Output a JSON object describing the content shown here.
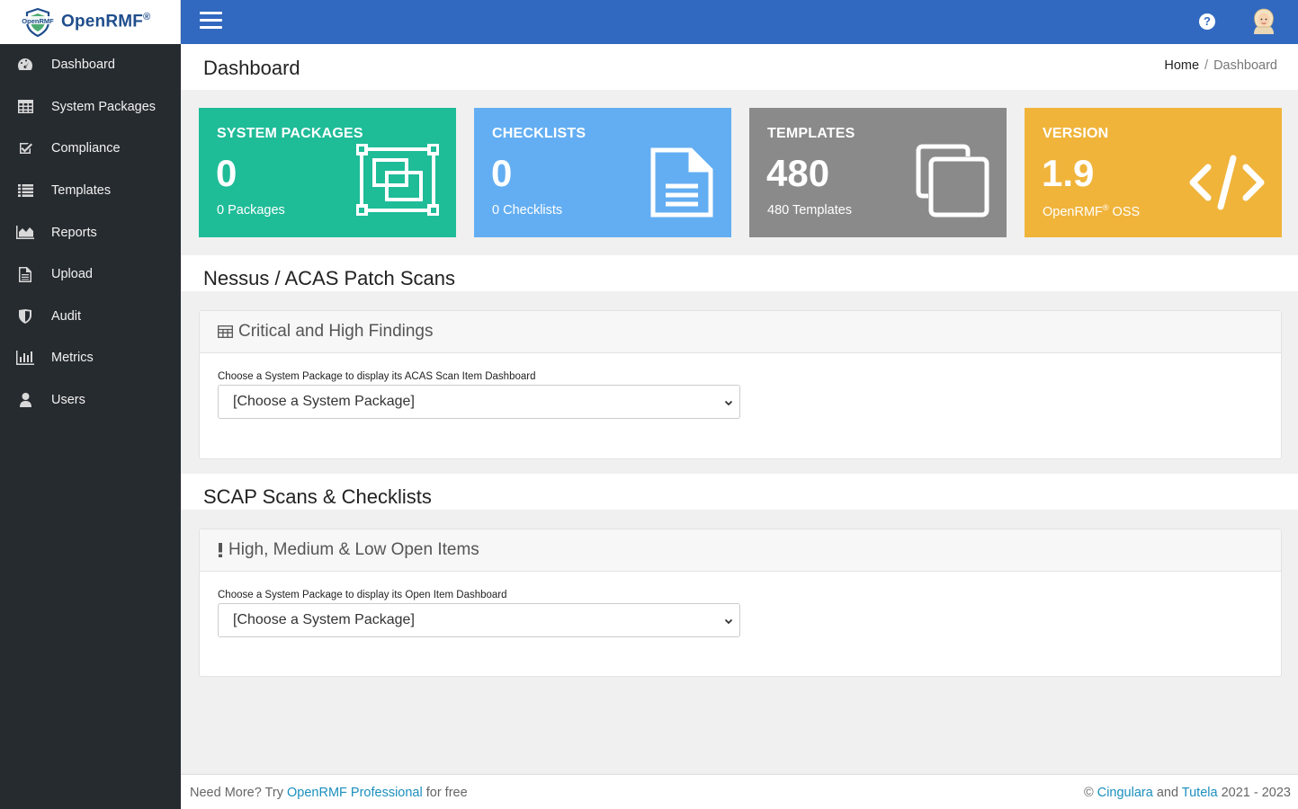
{
  "brand": {
    "name": "OpenRMF",
    "reg": "®",
    "logo_text": "OpenRMF"
  },
  "sidebar": {
    "items": [
      {
        "label": "Dashboard",
        "icon": "gauge-icon"
      },
      {
        "label": "System Packages",
        "icon": "table-icon"
      },
      {
        "label": "Compliance",
        "icon": "check-square-icon"
      },
      {
        "label": "Templates",
        "icon": "list-icon"
      },
      {
        "label": "Reports",
        "icon": "area-chart-icon"
      },
      {
        "label": "Upload",
        "icon": "file-icon"
      },
      {
        "label": "Audit",
        "icon": "shield-icon"
      },
      {
        "label": "Metrics",
        "icon": "bar-chart-icon"
      },
      {
        "label": "Users",
        "icon": "user-icon"
      }
    ]
  },
  "topbar": {
    "help": "?"
  },
  "header": {
    "title": "Dashboard",
    "breadcrumb": {
      "home": "Home",
      "separator": "/",
      "current": "Dashboard"
    }
  },
  "info_boxes": [
    {
      "title": "SYSTEM PACKAGES",
      "value": "0",
      "sub": "0 Packages",
      "color": "#1fbc98",
      "icon": "object-group-icon"
    },
    {
      "title": "CHECKLISTS",
      "value": "0",
      "sub": "0 Checklists",
      "color": "#63aef2",
      "icon": "file-text-icon"
    },
    {
      "title": "TEMPLATES",
      "value": "480",
      "sub": "480 Templates",
      "color": "#8a8a8a",
      "icon": "copy-icon"
    },
    {
      "title": "VERSION",
      "value": "1.9",
      "sub": "OpenRMF",
      "sub_reg": "®",
      "sub_suffix": " OSS",
      "color": "#f0b43b",
      "icon": "code-icon"
    }
  ],
  "sections": {
    "nessus": {
      "title": "Nessus / ACAS Patch Scans",
      "card_title": "Critical and High Findings",
      "label": "Choose a System Package to display its ACAS Scan Item Dashboard",
      "select_value": "[Choose a System Package]"
    },
    "scap": {
      "title": "SCAP Scans & Checklists",
      "card_title": "High, Medium & Low Open Items",
      "label": "Choose a System Package to display its Open Item Dashboard",
      "select_value": "[Choose a System Package]"
    }
  },
  "footer": {
    "left_prefix": "Need More? Try ",
    "left_link": "OpenRMF Professional",
    "left_suffix": " for free",
    "copyright": "©",
    "company1": "Cingulara",
    "and": " and ",
    "company2": "Tutela",
    "years": " 2021 - 2023"
  }
}
